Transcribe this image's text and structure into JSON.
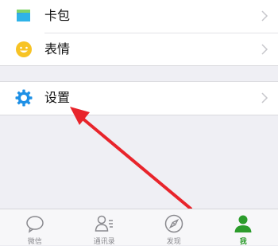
{
  "menu": {
    "items": [
      {
        "label": "卡包",
        "icon": "card-wallet-icon",
        "color": "#2fb3e8"
      },
      {
        "label": "表情",
        "icon": "emoji-smile-icon",
        "color": "#f7c325"
      },
      {
        "label": "设置",
        "icon": "gear-icon",
        "color": "#1e90e6"
      }
    ]
  },
  "tabbar": {
    "tabs": [
      {
        "label": "微信",
        "icon": "chat-bubble-icon",
        "active": false
      },
      {
        "label": "通讯录",
        "icon": "contacts-icon",
        "active": false
      },
      {
        "label": "发现",
        "icon": "compass-icon",
        "active": false
      },
      {
        "label": "我",
        "icon": "person-icon",
        "active": true
      }
    ]
  },
  "colors": {
    "active_tab": "#2c9c2c",
    "inactive_tab": "#8a8a8f",
    "annotation_arrow": "#e8242b"
  }
}
